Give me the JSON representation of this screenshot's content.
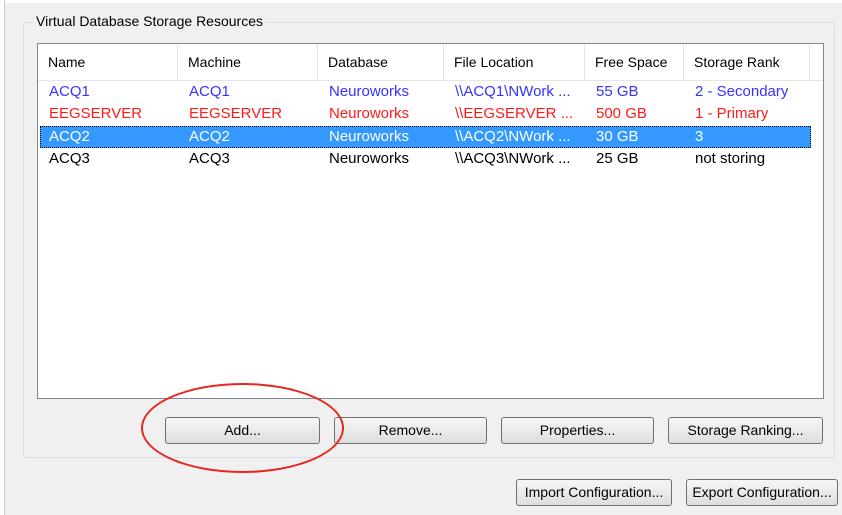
{
  "group": {
    "title": "Virtual Database Storage Resources"
  },
  "columns": [
    "Name",
    "Machine",
    "Database",
    "File Location",
    "Free Space",
    "Storage Rank"
  ],
  "rows": [
    {
      "cells": [
        "ACQ1",
        "ACQ1",
        "Neuroworks",
        "\\\\ACQ1\\NWork ...",
        "55 GB",
        "2 - Secondary"
      ],
      "color": "#3333ff",
      "selected": false
    },
    {
      "cells": [
        "EEGSERVER",
        "EEGSERVER",
        "Neuroworks",
        "\\\\EEGSERVER ...",
        "500 GB",
        "1 - Primary"
      ],
      "color": "#ff1a1a",
      "selected": false
    },
    {
      "cells": [
        "ACQ2",
        "ACQ2",
        "Neuroworks",
        "\\\\ACQ2\\NWork ...",
        "30 GB",
        "3"
      ],
      "color": "#ffffff",
      "selected": true
    },
    {
      "cells": [
        "ACQ3",
        "ACQ3",
        "Neuroworks",
        "\\\\ACQ3\\NWork ...",
        "25 GB",
        "not storing"
      ],
      "color": "#000000",
      "selected": false
    }
  ],
  "buttons": {
    "add": "Add...",
    "remove": "Remove...",
    "properties": "Properties...",
    "storage_ranking": "Storage Ranking...",
    "import_configuration": "Import Configuration...",
    "export_configuration": "Export Configuration..."
  },
  "colors": {
    "selection": "#3399ff",
    "annotation": "#e8261f"
  }
}
